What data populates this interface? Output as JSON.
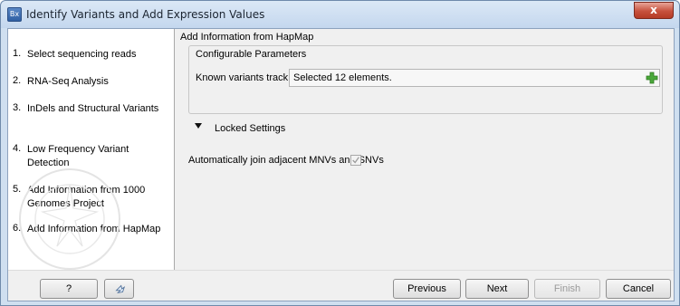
{
  "window": {
    "title": "Identify Variants and Add Expression Values",
    "app_icon_text": "Bx",
    "close_glyph": "x"
  },
  "steps": [
    {
      "num": "1.",
      "label": "Select sequencing reads"
    },
    {
      "num": "2.",
      "label": "RNA-Seq Analysis"
    },
    {
      "num": "3.",
      "label": "InDels and Structural Variants"
    },
    {
      "num": "4.",
      "label": "Low Frequency Variant Detection"
    },
    {
      "num": "5.",
      "label": "Add Information from 1000 Genomes Project"
    },
    {
      "num": "6.",
      "label": "Add Information from HapMap"
    }
  ],
  "main": {
    "section_title": "Add Information from HapMap",
    "configurable": {
      "title": "Configurable Parameters",
      "known_variants_label": "Known variants track",
      "known_variants_value": "Selected 12 elements."
    },
    "locked_settings_label": "Locked Settings",
    "auto_join_label": "Automatically join adjacent MNVs and SNVs",
    "auto_join_checked": true
  },
  "buttons": {
    "help": "?",
    "previous": "Previous",
    "next": "Next",
    "finish": "Finish",
    "cancel": "Cancel"
  },
  "icons": {
    "add": "green-plus-icon",
    "reset": "reset-arrow-icon",
    "locked": "triangle-down-icon"
  },
  "colors": {
    "titlebar": "#c4d7ee",
    "close": "#c7513d",
    "add_icon": "#3e9b2b"
  }
}
